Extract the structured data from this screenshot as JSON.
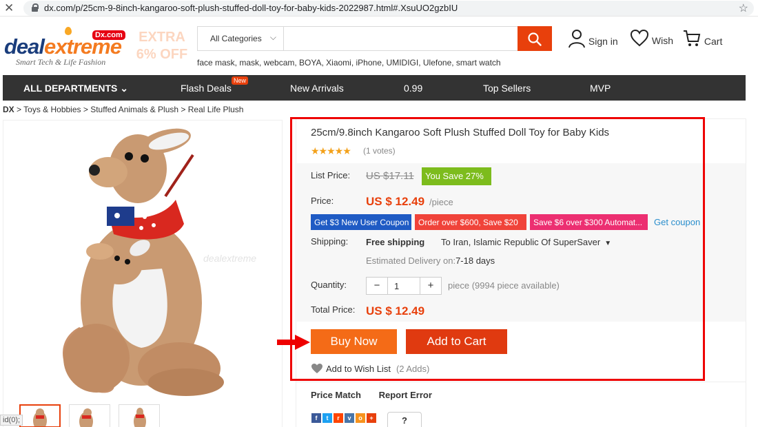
{
  "browser": {
    "url": "dx.com/p/25cm-9-8inch-kangaroo-soft-plush-stuffed-doll-toy-for-baby-kids-2022987.html#.XsuUO2gzbIU"
  },
  "header": {
    "logo_main": "deal",
    "logo_accent": "extreme",
    "logo_badge": "Dx.com",
    "tagline": "Smart Tech & Life Fashion",
    "promo_line1": "EXTRA",
    "promo_line2": "6% OFF",
    "category": "All Categories",
    "search_value": "",
    "hot_searches": "face mask, mask, webcam, BOYA, Xiaomi, iPhone, UMIDIGI, Ulefone, smart watch",
    "signin": "Sign in",
    "wish": "Wish",
    "cart": "Cart"
  },
  "nav": {
    "all_departments": "ALL DEPARTMENTS",
    "items": [
      "Flash Deals",
      "New Arrivals",
      "0.99",
      "Top Sellers",
      "MVP"
    ],
    "new_badge": "New"
  },
  "breadcrumb": [
    "DX",
    "Toys & Hobbies",
    "Stuffed Animals & Plush",
    "Real Life Plush"
  ],
  "product": {
    "title": "25cm/9.8inch Kangaroo Soft Plush Stuffed Doll Toy for Baby Kids",
    "rating_stars": "★★★★★",
    "votes": "(1 votes)",
    "list_price_label": "List Price:",
    "list_price": "US $17.11",
    "you_save": "You Save 27%",
    "price_label": "Price:",
    "price": "US $ 12.49",
    "per": "/piece",
    "coupons": [
      {
        "text": "Get $3 New User Coupon",
        "color": "#1f5bc4"
      },
      {
        "text": "Order over $600, Save $20",
        "color": "#f0433a"
      },
      {
        "text": "Save $6 over $300 Automat...",
        "color": "#ec2f71"
      }
    ],
    "get_coupon": "Get coupon",
    "shipping_label": "Shipping:",
    "free_shipping": "Free shipping",
    "ship_to": "To Iran, Islamic Republic Of SuperSaver",
    "delivery_label": "Estimated Delivery on:",
    "delivery_days": "7-18 days",
    "quantity_label": "Quantity:",
    "quantity": "1",
    "qty_minus": "−",
    "qty_plus": "+",
    "availability": "piece (9994 piece available)",
    "total_label": "Total Price:",
    "total": "US $ 12.49",
    "buy_now": "Buy Now",
    "add_to_cart": "Add to Cart",
    "add_to_wish": "Add to Wish List",
    "wish_adds": "(2 Adds)",
    "price_match": "Price Match",
    "report_error": "Report Error",
    "watermark": "dealextreme",
    "help": "?",
    "status": "id(0);"
  },
  "colors": {
    "accent": "#e8400c",
    "highlight_border": "#ee0000",
    "save_badge": "#7dbc1d",
    "nav_bg": "#333333"
  }
}
